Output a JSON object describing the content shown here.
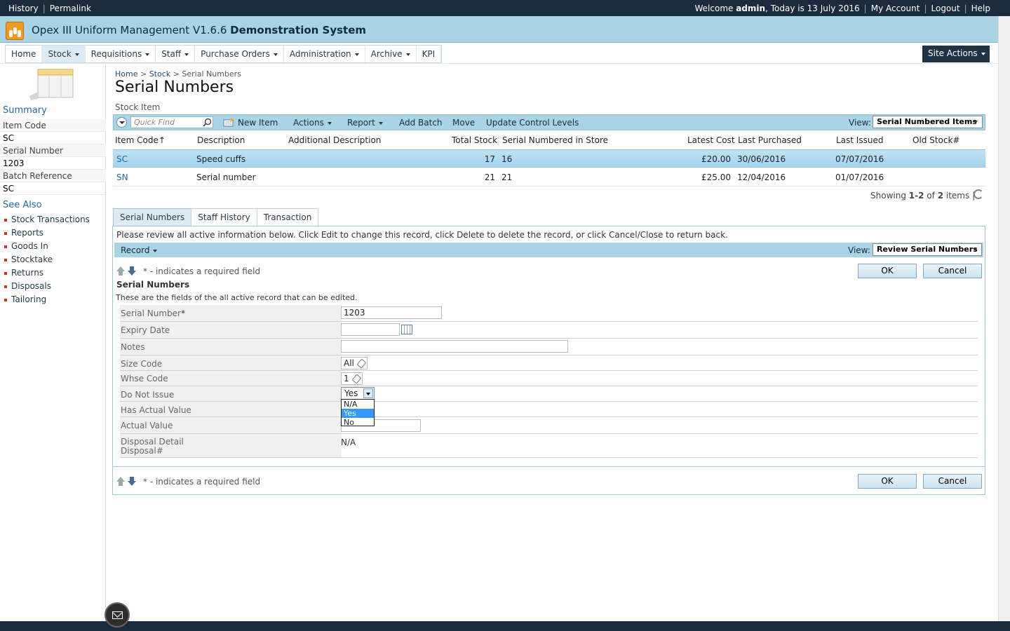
{
  "top": {
    "history": "History",
    "permalink": "Permalink",
    "welcome_prefix": "Welcome",
    "user": "admin",
    "date_text": ", Today is 13 July 2016",
    "my_account": "My Account",
    "logout": "Logout",
    "help": "Help"
  },
  "app": {
    "title_main": "Opex III Uniform Management V1.6.6",
    "title_bold": "Demonstration System"
  },
  "nav": {
    "items": [
      "Home",
      "Stock",
      "Requisitions",
      "Staff",
      "Purchase Orders",
      "Administration",
      "Archive",
      "KPI"
    ],
    "site_actions": "Site Actions"
  },
  "left": {
    "summary": "Summary",
    "item_code_label": "Item Code",
    "item_code_value": "SC",
    "serial_number_label": "Serial Number",
    "serial_number_value": "1203",
    "batch_reference_label": "Batch Reference",
    "batch_reference_value": "SC",
    "see_also": "See Also",
    "links": [
      "Stock Transactions",
      "Reports",
      "Goods In",
      "Stocktake",
      "Returns",
      "Disposals",
      "Tailoring"
    ]
  },
  "breadcrumb": {
    "home": "Home",
    "stock": "Stock",
    "current": "Serial Numbers"
  },
  "page_title": "Serial Numbers",
  "stock_item_label": "Stock Item",
  "toolbar": {
    "quick_find": "Quick Find",
    "new_item": "New Item",
    "actions": "Actions",
    "report": "Report",
    "add_batch": "Add Batch",
    "move": "Move",
    "update_control_levels": "Update Control Levels",
    "view_label": "View:",
    "view_value": "Serial Numbered Items"
  },
  "grid": {
    "columns": [
      "Item Code↑",
      "Description",
      "Additional Description",
      "Total Stock",
      "Serial Numbered in Store",
      "Latest Cost",
      "Last Purchased",
      "Last Issued",
      "Old Stock#"
    ],
    "rows": [
      {
        "code": "SC",
        "desc": "Speed cuffs",
        "addl": "",
        "total": "17",
        "instore": "16",
        "cost": "£20.00",
        "purchased": "30/06/2016",
        "issued": "07/07/2016",
        "old": ""
      },
      {
        "code": "SN",
        "desc": "Serial number",
        "addl": "",
        "total": "21",
        "instore": "21",
        "cost": "£25.00",
        "purchased": "12/04/2016",
        "issued": "01/07/2016",
        "old": ""
      }
    ],
    "showing_prefix": "Showing",
    "showing_range": "1-2",
    "showing_of": "of",
    "showing_total": "2",
    "showing_suffix": "items"
  },
  "tabs": [
    "Serial Numbers",
    "Staff History",
    "Transaction"
  ],
  "panel": {
    "info": "Please review all active information below. Click Edit to change this record, click Delete to delete the record, or click Cancel/Close to return back.",
    "record": "Record",
    "view_label": "View:",
    "view_value": "Review Serial Numbers",
    "required_note": "* - indicates a required field",
    "ok": "OK",
    "cancel": "Cancel",
    "form_title": "Serial Numbers",
    "form_desc": "These are the fields of the all active record that can be edited."
  },
  "form": {
    "serial_number_label": "Serial Number",
    "serial_number_value": "1203",
    "expiry_date_label": "Expiry Date",
    "notes_label": "Notes",
    "size_code_label": "Size Code",
    "size_code_value": "All",
    "whse_code_label": "Whse Code",
    "whse_code_value": "1",
    "do_not_issue_label": "Do Not Issue",
    "do_not_issue_value": "Yes",
    "do_not_issue_options": [
      "N/A",
      "Yes",
      "No"
    ],
    "has_actual_value_label": "Has Actual Value",
    "actual_value_label": "Actual Value",
    "disposal_detail_label": "Disposal Detail",
    "disposal_num_label": "Disposal#",
    "disposal_value": "N/A"
  }
}
